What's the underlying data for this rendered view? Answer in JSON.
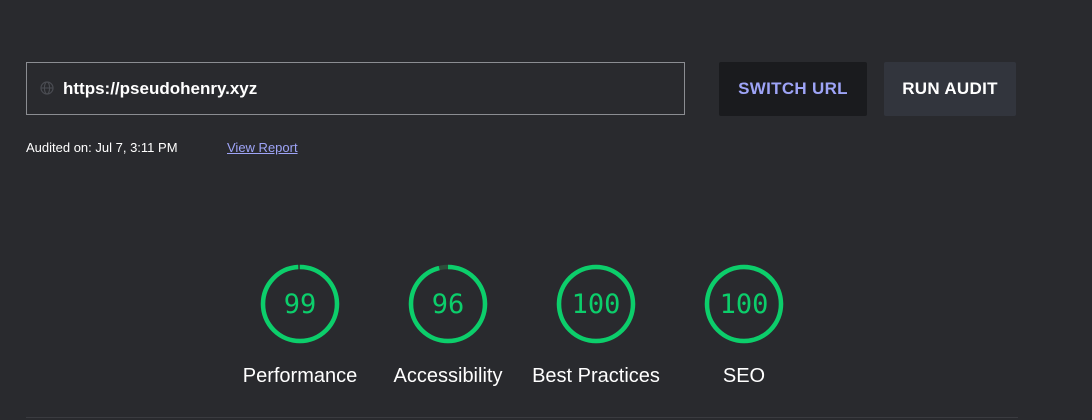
{
  "colors": {
    "background": "#292a2e",
    "pass": "#0cce6b",
    "pass_track": "#2c4f3a",
    "link": "#9ea4f7",
    "switch_label": "#9ea4f7",
    "divider": "#3a3b40"
  },
  "url_bar": {
    "icon": "globe-icon",
    "url": "https://pseudohenry.xyz"
  },
  "buttons": {
    "switch_url": "SWITCH URL",
    "run_audit": "RUN AUDIT"
  },
  "audit_info": {
    "audited_on": "Audited on: Jul 7, 3:11 PM",
    "view_report": "View Report"
  },
  "gauges": [
    {
      "label": "Performance",
      "score": 99,
      "score_text": "99"
    },
    {
      "label": "Accessibility",
      "score": 96,
      "score_text": "96"
    },
    {
      "label": "Best Practices",
      "score": 100,
      "score_text": "100"
    },
    {
      "label": "SEO",
      "score": 100,
      "score_text": "100"
    }
  ]
}
